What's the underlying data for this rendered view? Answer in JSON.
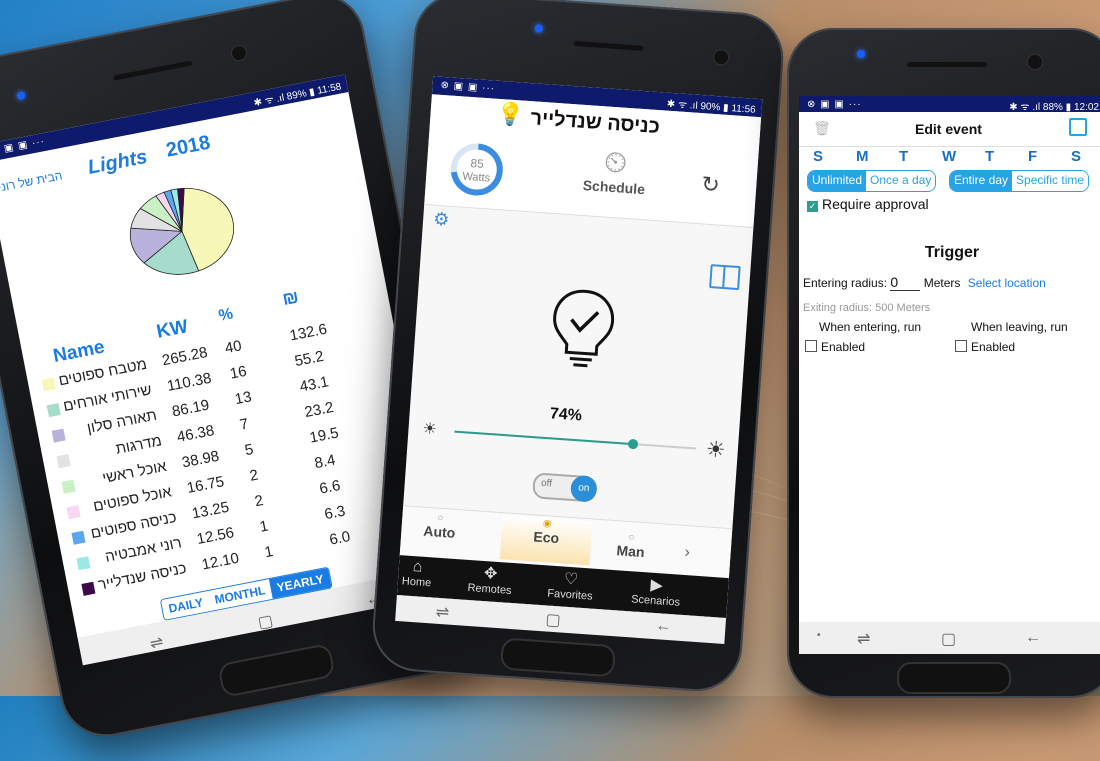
{
  "phone1": {
    "status_icons_left": "⊗ ▣ ▣ ···",
    "status_right": "✱ ᯤ .ıl 89% ▮ 11:58",
    "home_name": "הבית של רוני",
    "title": "Lights",
    "year": "2018",
    "col_name": "Name",
    "col_kw": "KW",
    "col_pct": "%",
    "col_shekel": "₪",
    "rows": [
      {
        "name": "מטבח ספוטים",
        "kw": "265.28",
        "pct": "40",
        "shekel": "132.6",
        "color": "#f7f7b8"
      },
      {
        "name": "שירותי אורחים",
        "kw": "110.38",
        "pct": "16",
        "shekel": "55.2",
        "color": "#a6dccb"
      },
      {
        "name": "תאורה סלון",
        "kw": "86.19",
        "pct": "13",
        "shekel": "43.1",
        "color": "#b9b2dc"
      },
      {
        "name": "מדרגות",
        "kw": "46.38",
        "pct": "7",
        "shekel": "23.2",
        "color": "#e2e2e2"
      },
      {
        "name": "אוכל ראשי",
        "kw": "38.98",
        "pct": "5",
        "shekel": "19.5",
        "color": "#c9f1c4"
      },
      {
        "name": "אוכל ספוטים",
        "kw": "16.75",
        "pct": "2",
        "shekel": "8.4",
        "color": "#f8d7f2"
      },
      {
        "name": "כניסה ספוטים",
        "kw": "13.25",
        "pct": "2",
        "shekel": "6.6",
        "color": "#5aa7f0"
      },
      {
        "name": "רוני אמבטיה",
        "kw": "12.56",
        "pct": "1",
        "shekel": "6.3",
        "color": "#9be9e6"
      },
      {
        "name": "כניסה שנדלייר",
        "kw": "12.10",
        "pct": "1",
        "shekel": "6.0",
        "color": "#3a0b48"
      }
    ],
    "tabs": [
      "DAILY",
      "MONTHL",
      "YEARLY"
    ],
    "active_tab": "YEARLY"
  },
  "phone2": {
    "status_icons_left": "⊗ ▣ ▣ ···",
    "status_right": "✱ ᯤ .ıl 90% ▮ 11:56",
    "title": "כניסה שנדלייר",
    "watts_value": "85",
    "watts_unit": "Watts",
    "watts_fraction": 0.72,
    "schedule_label": "Schedule",
    "brightness": "74%",
    "brightness_value": 0.74,
    "toggle_off": "off",
    "toggle_on": "on",
    "modes": [
      "Auto",
      "Eco",
      "Man"
    ],
    "active_mode": "Eco",
    "bottom_nav": [
      "Home",
      "Remotes",
      "Favorites",
      "Scenarios"
    ],
    "accent": "#2a9d8f"
  },
  "phone3": {
    "status_icons_left": "⊗ ▣ ▣ ···",
    "status_right": "✱ ᯤ .ıl 88% ▮ 12:02",
    "header_title": "Edit event",
    "days": [
      "S",
      "M",
      "T",
      "W",
      "T",
      "F",
      "S"
    ],
    "freq_options": [
      "Unlimited",
      "Once a day"
    ],
    "freq_selected": "Unlimited",
    "time_options": [
      "Entire day",
      "Specific time"
    ],
    "time_selected": "Entire day",
    "require_approval": "Require approval",
    "trigger_title": "Trigger",
    "entering_label": "Entering radius:",
    "entering_value": "0",
    "entering_unit": "Meters",
    "select_location": "Select location",
    "exiting_label": "Exiting radius: 500 Meters",
    "when_entering": "When entering, run",
    "when_leaving": "When leaving, run",
    "enabled_label": "Enabled",
    "accent": "#27a3e6"
  }
}
